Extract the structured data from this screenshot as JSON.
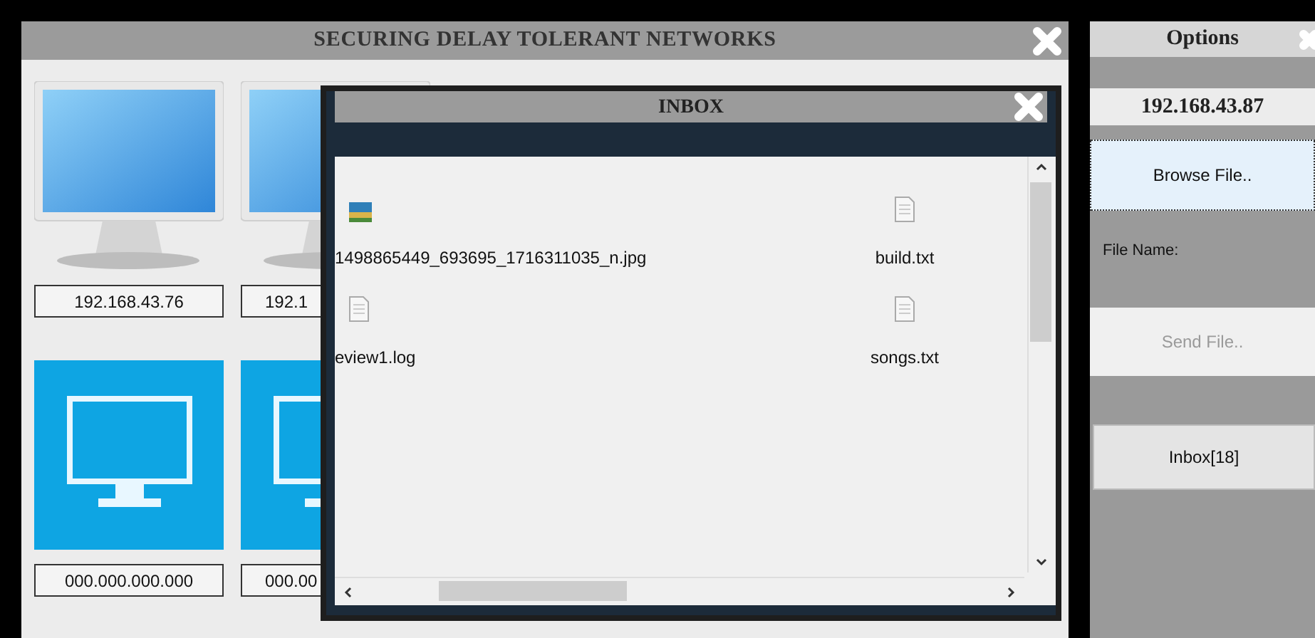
{
  "main_window": {
    "title": "SECURING DELAY TOLERANT NETWORKS",
    "nodes": [
      {
        "kind": "glossy",
        "address": "192.168.43.76"
      },
      {
        "kind": "glossy",
        "address": "192.1"
      },
      {
        "kind": "flat",
        "address": "000.000.000.000"
      },
      {
        "kind": "flat",
        "address": "000.00"
      }
    ]
  },
  "inbox": {
    "title": "INBOX",
    "files": [
      {
        "kind": "image",
        "name": "1498865449_693695_1716311035_n.jpg"
      },
      {
        "kind": "text",
        "name": "build.txt"
      },
      {
        "kind": "text",
        "name": "eview1.log"
      },
      {
        "kind": "text",
        "name": "songs.txt"
      }
    ]
  },
  "options": {
    "title": "Options",
    "address": "192.168.43.87",
    "browse_button": "Browse File..",
    "file_name_label": "File Name:",
    "send_button": {
      "label": "Send File..",
      "disabled": true
    },
    "inbox_button": "Inbox[18]"
  }
}
